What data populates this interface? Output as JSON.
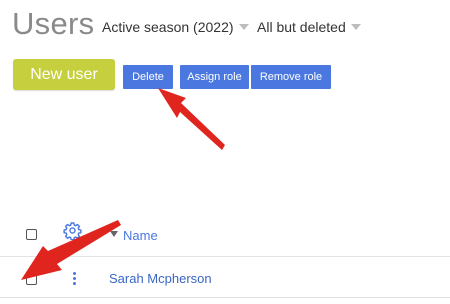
{
  "page": {
    "title": "Users"
  },
  "filters": [
    {
      "label": "Active season (2022)"
    },
    {
      "label": "All but deleted"
    }
  ],
  "actions": {
    "new_user": "New user",
    "delete": "Delete",
    "assign_role": "Assign role",
    "remove_role": "Remove role"
  },
  "table": {
    "columns": {
      "name": "Name"
    },
    "rows": [
      {
        "name": "Sarah Mcpherson"
      }
    ]
  },
  "icons": [
    "gear-icon",
    "sort-caret-icon",
    "kebab-menu-icon",
    "dropdown-caret-icon"
  ],
  "colors": {
    "accent_blue": "#4a78e0",
    "new_user_green": "#c6cf3e",
    "annotation_red": "#e0251f"
  }
}
